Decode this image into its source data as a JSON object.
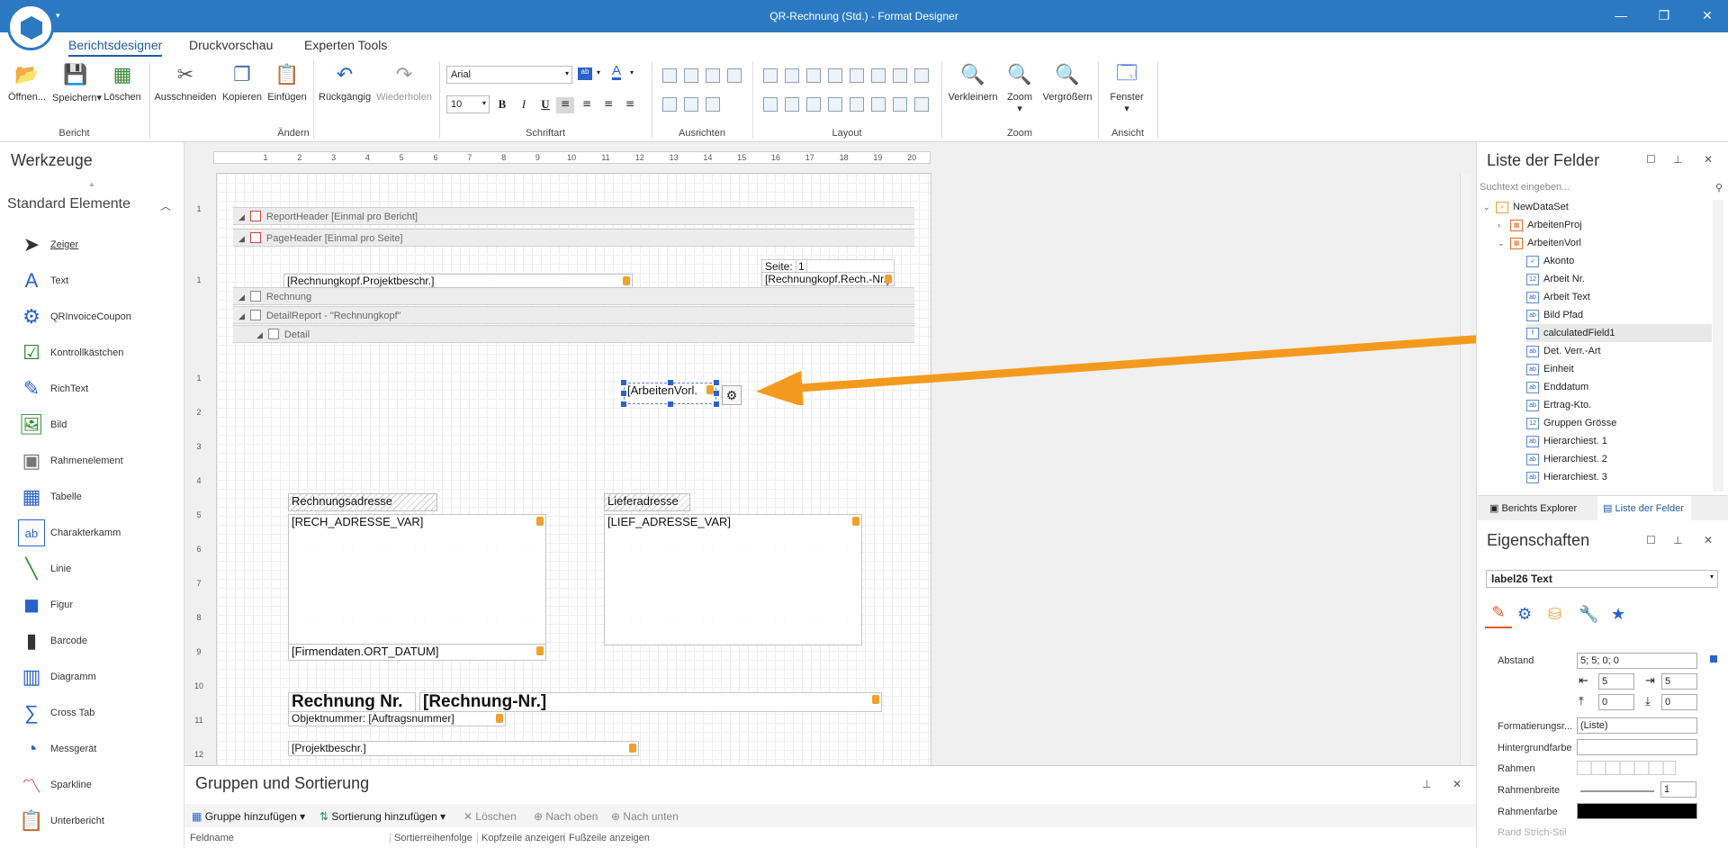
{
  "window": {
    "title": "QR-Rechnung (Std.) - Format Designer",
    "minimize": "—",
    "restore": "❐",
    "close": "✕"
  },
  "tabs": [
    {
      "label": "Berichtsdesigner"
    },
    {
      "label": "Druckvorschau"
    },
    {
      "label": "Experten Tools"
    }
  ],
  "ribbon": {
    "bericht": {
      "label": "Bericht",
      "open": "Öffnen...",
      "save": "Speichern",
      "delete": "Löschen"
    },
    "aendern": {
      "label": "Ändern",
      "cut": "Ausschneiden",
      "copy": "Kopieren",
      "paste": "Einfügen"
    },
    "undo": "Rückgängig",
    "redo": "Wiederholen",
    "schriftart": {
      "label": "Schriftart",
      "font": "Arial",
      "size": "10",
      "bold": "B",
      "italic": "I",
      "underline": "U"
    },
    "ausrichten": {
      "label": "Ausrichten"
    },
    "layout": {
      "label": "Layout"
    },
    "zoom": {
      "label": "Zoom",
      "out": "Verkleinern",
      "zoom": "Zoom",
      "in": "Vergrößern"
    },
    "ansicht": {
      "label": "Ansicht",
      "window": "Fenster"
    }
  },
  "toolbox": {
    "title": "Werkzeuge",
    "category": "Standard Elemente",
    "items": [
      {
        "label": "Zeiger",
        "icon": "pointer-icon"
      },
      {
        "label": "Text",
        "icon": "text-icon"
      },
      {
        "label": "QRInvoiceCoupon",
        "icon": "gear-icon"
      },
      {
        "label": "Kontrollkästchen",
        "icon": "checkbox-icon"
      },
      {
        "label": "RichText",
        "icon": "richtext-icon"
      },
      {
        "label": "Bild",
        "icon": "picture-icon"
      },
      {
        "label": "Rahmenelement",
        "icon": "panel-icon"
      },
      {
        "label": "Tabelle",
        "icon": "table-icon"
      },
      {
        "label": "Charakterkamm",
        "icon": "charactercomb-icon"
      },
      {
        "label": "Linie",
        "icon": "line-icon"
      },
      {
        "label": "Figur",
        "icon": "shape-icon"
      },
      {
        "label": "Barcode",
        "icon": "barcode-icon"
      },
      {
        "label": "Diagramm",
        "icon": "chart-icon"
      },
      {
        "label": "Cross Tab",
        "icon": "crosstab-icon"
      },
      {
        "label": "Messgerät",
        "icon": "gauge-icon"
      },
      {
        "label": "Sparkline",
        "icon": "sparkline-icon"
      },
      {
        "label": "Unterbericht",
        "icon": "subreport-icon"
      }
    ]
  },
  "ruler": [
    "1",
    "2",
    "3",
    "4",
    "5",
    "6",
    "7",
    "8",
    "9",
    "10",
    "11",
    "12",
    "13",
    "14",
    "15",
    "16",
    "17",
    "18",
    "19",
    "20"
  ],
  "vruler": [
    "1",
    "1",
    "1",
    "2",
    "3",
    "4",
    "5",
    "6",
    "7",
    "8",
    "9",
    "10",
    "11",
    "12"
  ],
  "bands": {
    "reportheader": "ReportHeader [Einmal pro Bericht]",
    "pageheader": "PageHeader [Einmal pro Seite]",
    "rechnung": "Rechnung",
    "detailreport": "DetailReport - \"Rechnungkopf\"",
    "detail": "Detail"
  },
  "fields": {
    "projektbeschr_head": "[Rechnungkopf.Projektbeschr.]",
    "seite_label": "Seite:",
    "seite_value": "1",
    "rech_nr_head": "[Rechnungkopf.Rech.-Nr.]",
    "arbeitenvorl": "[ArbeitenVorl.",
    "rechnungsadresse": "Rechnungsadresse",
    "lieferadresse": "Lieferadresse",
    "rech_adresse": "[RECH_ADRESSE_VAR]",
    "lief_adresse": "[LIEF_ADRESSE_VAR]",
    "ort_datum": "[Firmendaten.ORT_DATUM]",
    "rechnung_nr_label": "Rechnung Nr.",
    "rechnung_nr_value": "[Rechnung-Nr.]",
    "objektnummer": "Objektnummer: [Auftragsnummer]",
    "projektbeschr": "[Projektbeschr.]"
  },
  "fieldlist": {
    "title": "Liste der Felder",
    "search_placeholder": "Suchtext eingeben...",
    "nodes": [
      {
        "label": "NewDataSet",
        "type": "ds"
      },
      {
        "label": "ArbeitenProj",
        "type": "tbl"
      },
      {
        "label": "ArbeitenVorl",
        "type": "tbl"
      },
      {
        "label": "Akonto",
        "type": "✓"
      },
      {
        "label": "Arbeit Nr.",
        "type": "12"
      },
      {
        "label": "Arbeit Text",
        "type": "ab"
      },
      {
        "label": "Bild Pfad",
        "type": "ab"
      },
      {
        "label": "calculatedField1",
        "type": "f"
      },
      {
        "label": "Det. Verr.-Art",
        "type": "ab"
      },
      {
        "label": "Einheit",
        "type": "ab"
      },
      {
        "label": "Enddatum",
        "type": "ab"
      },
      {
        "label": "Ertrag-Kto.",
        "type": "ab"
      },
      {
        "label": "Gruppen Grösse",
        "type": "12"
      },
      {
        "label": "Hierarchiest. 1",
        "type": "ab"
      },
      {
        "label": "Hierarchiest. 2",
        "type": "ab"
      },
      {
        "label": "Hierarchiest. 3",
        "type": "ab"
      }
    ],
    "tab_explorer": "Berichts Explorer",
    "tab_fields": "Liste der Felder"
  },
  "properties": {
    "title": "Eigenschaften",
    "selected": "label26  Text",
    "abstand_label": "Abstand",
    "abstand_value": "5; 5; 0; 0",
    "pad_left": "5",
    "pad_right": "5",
    "pad_top": "0",
    "pad_bottom": "0",
    "formatierung_label": "Formatierungsr...",
    "formatierung_value": "(Liste)",
    "hintergrund_label": "Hintergrundfarbe",
    "rahmen_label": "Rahmen",
    "rahmenbreite_label": "Rahmenbreite",
    "rahmenbreite_value": "1",
    "rahmenfarbe_label": "Rahmenfarbe",
    "cut_label": "Rand Strich-Stil"
  },
  "groups": {
    "title": "Gruppen und Sortierung",
    "add_group": "Gruppe hinzufügen",
    "add_sort": "Sortierung hinzufügen",
    "delete": "Löschen",
    "up": "Nach oben",
    "down": "Nach unten",
    "columns": [
      "Feldname",
      "Sortierreihenfolge",
      "Kopfzeile anzeigen",
      "Fußzeile anzeigen"
    ]
  },
  "colors": {
    "accent": "#2b79c2",
    "arrow": "#f39a1e",
    "field_icon": "#f0a030"
  }
}
